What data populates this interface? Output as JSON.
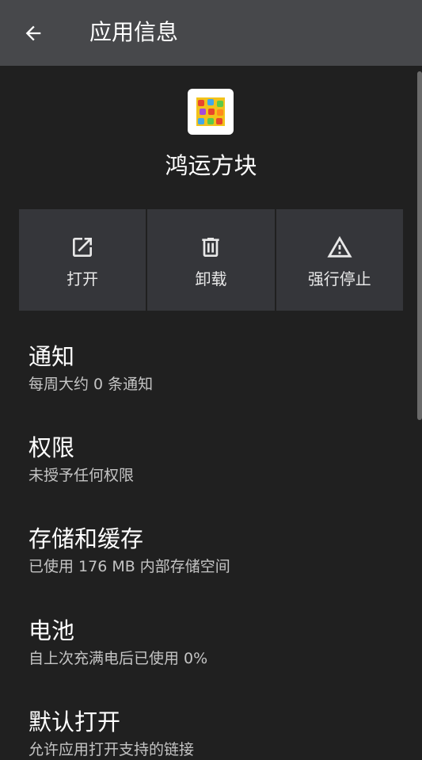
{
  "appbar": {
    "title": "应用信息",
    "back_icon": "arrow-left-icon"
  },
  "app": {
    "name": "鸿运方块",
    "icon": "app-icon"
  },
  "actions": [
    {
      "label": "打开",
      "icon": "open-external-icon"
    },
    {
      "label": "卸载",
      "icon": "trash-icon"
    },
    {
      "label": "强行停止",
      "icon": "warning-icon"
    }
  ],
  "settings": [
    {
      "title": "通知",
      "subtitle": "每周大约 0 条通知"
    },
    {
      "title": "权限",
      "subtitle": "未授予任何权限"
    },
    {
      "title": "存储和缓存",
      "subtitle": "已使用 176 MB 内部存储空间"
    },
    {
      "title": "电池",
      "subtitle": "自上次充满电后已使用 0%"
    },
    {
      "title": "默认打开",
      "subtitle": "允许应用打开支持的链接"
    }
  ],
  "colors": {
    "background": "#202020",
    "appbar": "#47484b",
    "action_tile": "#35363a",
    "subtitle_text": "#c4c4c4"
  }
}
